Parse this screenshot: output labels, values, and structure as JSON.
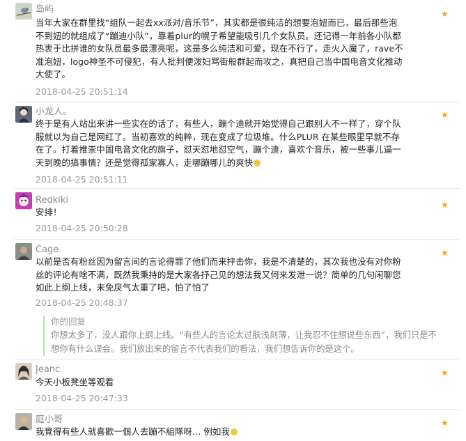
{
  "comments": [
    {
      "name": "岛屿",
      "avatar_icon": "bird-on-branch-avatar",
      "text": "当年大家在群里找“组队一起去xx派对/音乐节”，其实都是很纯洁的想要泡妞而已，最后那些泡不到妞的就组成了“蹦迪小队”，靠着plur的幌子希望能吸引几个女队员。还记得一年前各小队都热衷于比拼谁的女队员最多最漂亮呢，这是多么纯洁和可爱，现在不行了，走火入魔了，rave不准泡妞，logo神圣不可侵犯，有人批判便泼妇骂街般群起而攻之，真把自己当中国电音文化推动大使了。",
      "time": "2018-04-25 20:51:14"
    },
    {
      "name": "小龙人。",
      "avatar_icon": "girl-photo-avatar",
      "text": "终于是有人站出来讲一些实在的话了，有些人，蹦个迪就开始觉得自己跟别人不一样了，穿个队服就以为自己是网红了。当初喜欢的纯粹，现在变成了垃圾堆。什么PLUR 在某些眼里早就不存在了。打着推崇中国电音文化的旗子，怼天怼地怼空气，蹦个迪，喜欢个音乐，被一些事儿逼一天到晚的搞事情？还是觉得孤家寡人，走哪蹦哪儿的爽快",
      "time": "2018-04-25 20:51:11"
    },
    {
      "name": "Redkiki",
      "avatar_icon": "purple-cartoon-avatar",
      "text": "安排！",
      "time": "2018-04-25 20:50:28"
    },
    {
      "name": "Cage",
      "avatar_icon": "man-photo-avatar",
      "text": "以前是否有粉丝因为留言间的言论得罪了他们而来抨击你，我是不清楚的，其次我也没有对你粉丝的评论有啥不满，既然我秉持的是大家各抒己见的想法我又何来发泄一说？简单的几句闲聊您如此上纲上线，未免戾气太重了吧，怕了怕了",
      "time": "2018-04-25 20:48:37",
      "reply_label": "你的回复",
      "reply_text": "你想太多了，没人跟你上纲上线。“有些人的言论太过肤浅刻薄，让我忍不住想说些东西”，我们只是不想你有什么误会。我们放出来的留言不代表我们的看法，我们想告诉你的是这个。"
    },
    {
      "name": "Jeanc",
      "avatar_icon": "woman-photo-avatar",
      "text": "今天小板凳坐等观看",
      "time": "2018-04-25 20:47:33"
    },
    {
      "name": "庭小哥",
      "avatar_icon": "person-photo-avatar",
      "text": "我覺得有些人就喜歡一個人去蹦不組隊呀… 例如我",
      "time": ""
    }
  ],
  "star_glyph": "★",
  "colors": {
    "star": "#f3a52b",
    "reply_border": "#b7e0a5"
  }
}
